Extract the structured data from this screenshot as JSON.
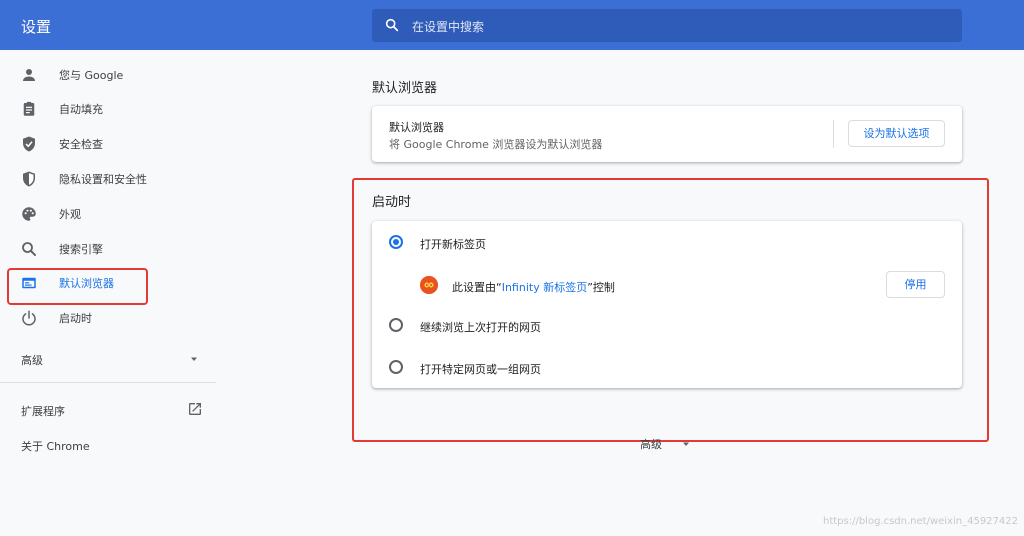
{
  "header": {
    "title": "设置",
    "search_placeholder": "在设置中搜索"
  },
  "sidebar": {
    "items": [
      {
        "label": "您与 Google",
        "icon": "person-icon"
      },
      {
        "label": "自动填充",
        "icon": "clipboard-icon"
      },
      {
        "label": "安全检查",
        "icon": "shield-check-icon"
      },
      {
        "label": "隐私设置和安全性",
        "icon": "privacy-shield-icon"
      },
      {
        "label": "外观",
        "icon": "palette-icon"
      },
      {
        "label": "搜索引擎",
        "icon": "search-icon"
      },
      {
        "label": "默认浏览器",
        "icon": "browser-window-icon",
        "active": true
      },
      {
        "label": "启动时",
        "icon": "power-icon"
      }
    ],
    "advanced_label": "高级",
    "extensions_label": "扩展程序",
    "about_label": "关于 Chrome"
  },
  "main": {
    "default_browser": {
      "section_title": "默认浏览器",
      "card_title": "默认浏览器",
      "card_subtitle": "将 Google Chrome 浏览器设为默认浏览器",
      "button_label": "设为默认选项"
    },
    "startup": {
      "section_title": "启动时",
      "options": [
        {
          "label": "打开新标签页",
          "checked": true
        },
        {
          "label": "继续浏览上次打开的网页",
          "checked": false
        },
        {
          "label": "打开特定网页或一组网页",
          "checked": false
        }
      ],
      "controlled_prefix": "此设置由“",
      "controlled_ext_name": "Infinity 新标签页",
      "controlled_suffix": "”控制",
      "disable_button": "停用"
    },
    "advanced_label": "高级"
  },
  "watermark": "https://blog.csdn.net/weixin_45927422",
  "colors": {
    "topbar": "#3b6fd6",
    "accent": "#1a73e8",
    "annotation_red": "#e53935",
    "extension_icon": "#e8531f"
  }
}
